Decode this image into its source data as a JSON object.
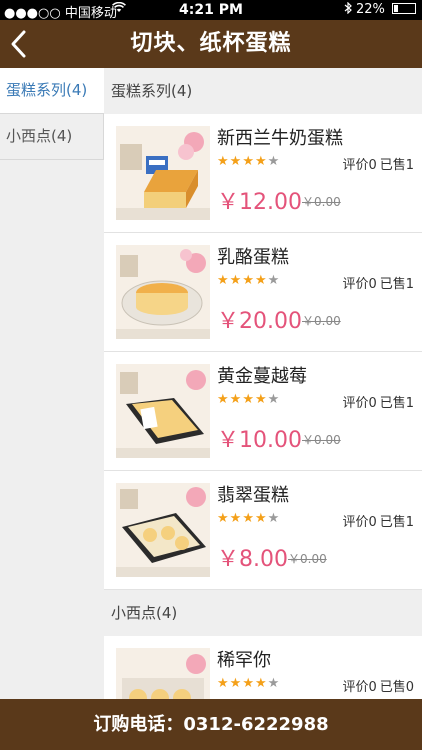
{
  "status_bar": {
    "carrier": "●●●○○ 中国移动",
    "time": "4:21 PM",
    "battery": "22%"
  },
  "header": {
    "title": "切块、纸杯蛋糕",
    "back_icon": "chevron-left-icon"
  },
  "sidebar": {
    "items": [
      {
        "label": "蛋糕系列(4)",
        "active": true
      },
      {
        "label": "小西点(4)",
        "active": false
      }
    ]
  },
  "sections": [
    {
      "title": "蛋糕系列(4)",
      "products": [
        {
          "name": "新西兰牛奶蛋糕",
          "rating": 4,
          "reviews": "评价0",
          "sold": "已售1",
          "price": "￥12.00",
          "old_price": "￥0.00"
        },
        {
          "name": "乳酪蛋糕",
          "rating": 4,
          "reviews": "评价0",
          "sold": "已售1",
          "price": "￥20.00",
          "old_price": "￥0.00"
        },
        {
          "name": "黄金蔓越莓",
          "rating": 4,
          "reviews": "评价0",
          "sold": "已售1",
          "price": "￥10.00",
          "old_price": "￥0.00"
        },
        {
          "name": "翡翠蛋糕",
          "rating": 4,
          "reviews": "评价0",
          "sold": "已售1",
          "price": "￥8.00",
          "old_price": "￥0.00"
        }
      ]
    },
    {
      "title": "小西点(4)",
      "products": [
        {
          "name": "稀罕你",
          "rating": 4,
          "reviews": "评价0",
          "sold": "已售0",
          "price": "",
          "old_price": ""
        }
      ]
    }
  ],
  "footer": {
    "phone_label": "订购电话：0312-6222988"
  },
  "colors": {
    "brand": "#5a391a",
    "price": "#e4537a",
    "star": "#f4a019",
    "active_tab_text": "#3a7ab6"
  }
}
